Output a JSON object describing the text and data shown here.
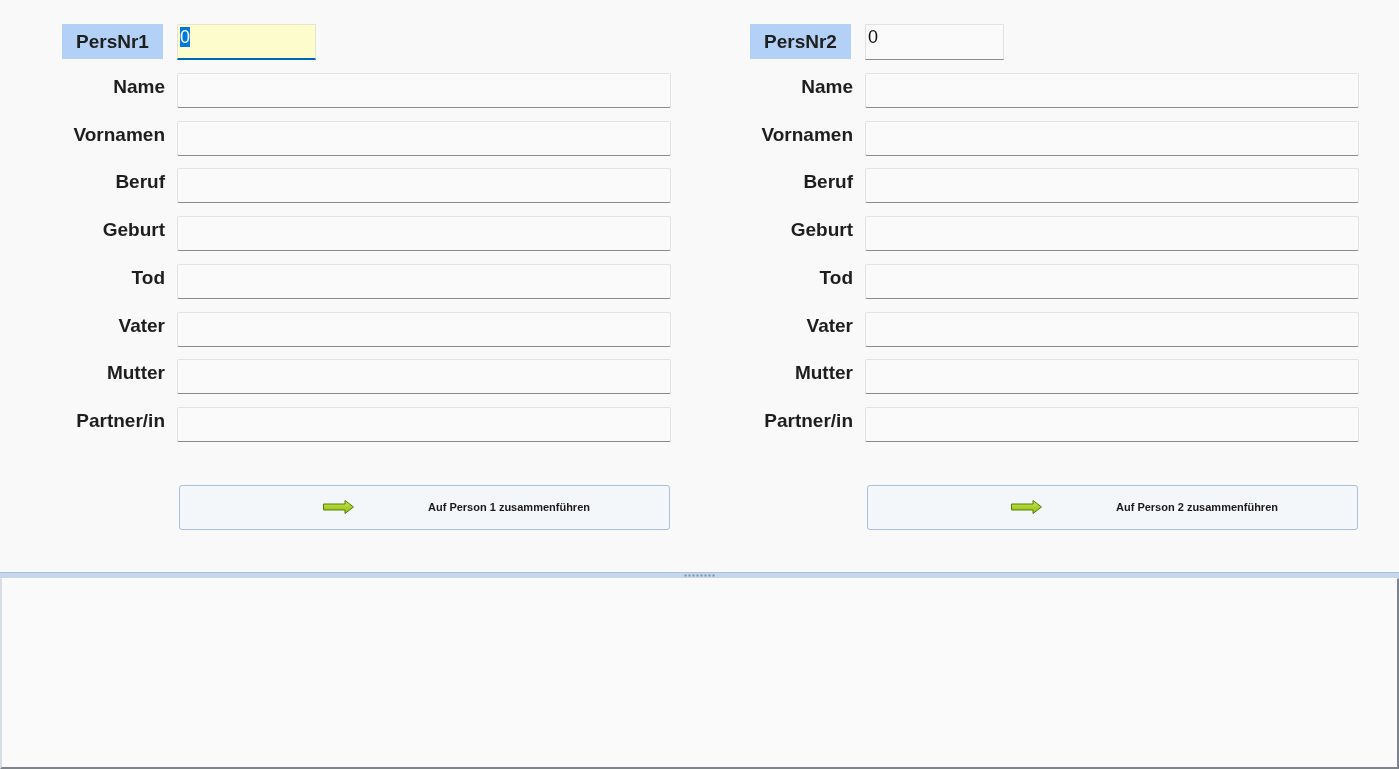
{
  "panels": [
    {
      "id_label": "PersNr1",
      "id_field": {
        "value": "0",
        "focused": true
      },
      "fields": [
        {
          "label": "Name"
        },
        {
          "label": "Vornamen"
        },
        {
          "label": "Beruf"
        },
        {
          "label": "Geburt"
        },
        {
          "label": "Tod"
        },
        {
          "label": "Vater"
        },
        {
          "label": "Mutter"
        },
        {
          "label": "Partner/in"
        }
      ],
      "merge_button": "Auf Person 1 zusammenführen"
    },
    {
      "id_label": "PersNr2",
      "id_field": {
        "value": "0",
        "focused": false
      },
      "fields": [
        {
          "label": "Name"
        },
        {
          "label": "Vornamen"
        },
        {
          "label": "Beruf"
        },
        {
          "label": "Geburt"
        },
        {
          "label": "Tod"
        },
        {
          "label": "Vater"
        },
        {
          "label": "Mutter"
        },
        {
          "label": "Partner/in"
        }
      ],
      "merge_button": "Auf Person 2 zusammenführen"
    }
  ]
}
